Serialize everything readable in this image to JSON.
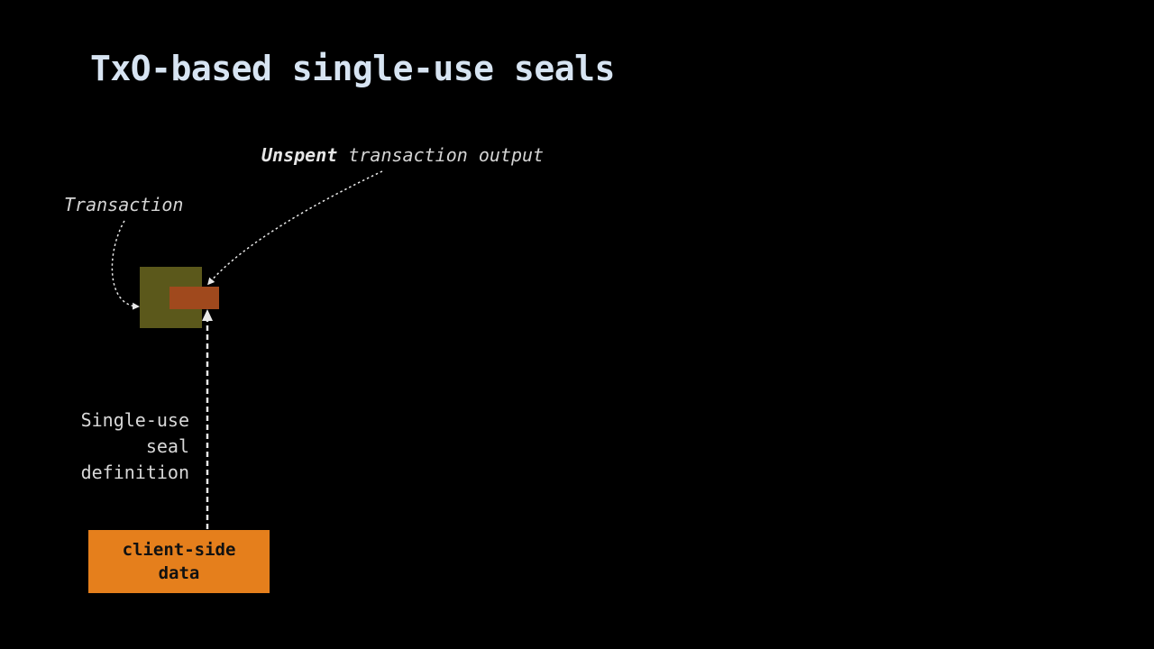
{
  "slide": {
    "title": "TxO-based single-use seals"
  },
  "diagram": {
    "utxo_label": {
      "bold": "Unspent",
      "rest": " transaction output"
    },
    "transaction_label": "Transaction",
    "seal_definition_label": [
      "Single-use",
      "seal",
      "definition"
    ],
    "client_data_box": [
      "client-side",
      "data"
    ],
    "colors": {
      "background": "#000000",
      "title": "#d7e4f2",
      "transaction_box": "#5b581b",
      "output_box": "#a0491d",
      "client_data_box": "#e57f1c",
      "arrow": "#e8e8e8"
    }
  }
}
